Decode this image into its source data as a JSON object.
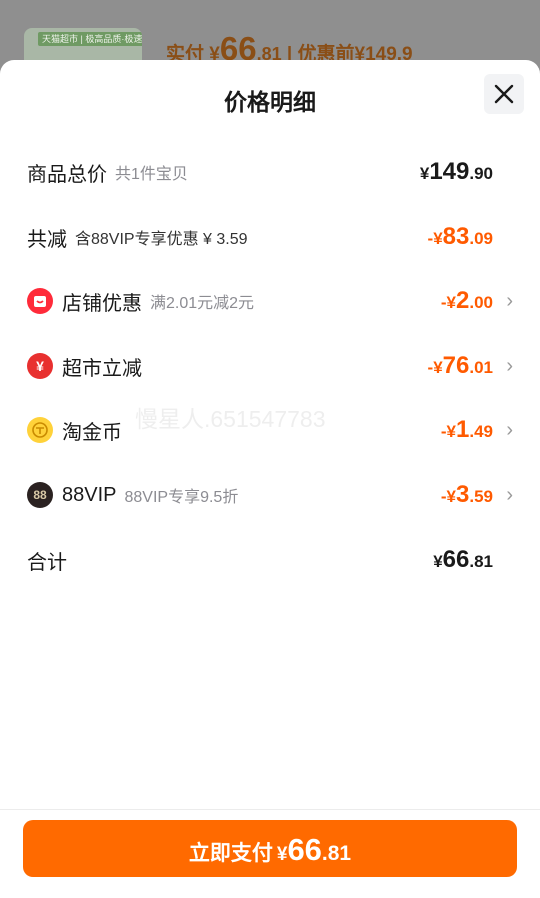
{
  "background": {
    "thumb_tag": "天猫超市 | 极高品质·极速送达",
    "price_prefix": "实付",
    "price_currency": "¥",
    "price_int": "66",
    "price_dec": ".81",
    "orig_label": "| 优惠前",
    "orig_price": "¥149.9"
  },
  "sheet": {
    "title": "价格明细",
    "close_icon": "close-icon"
  },
  "rows": {
    "goods_total": {
      "label": "商品总价",
      "sub": "共1件宝贝",
      "cur": "¥",
      "int": "149",
      "dec": ".90"
    },
    "total_discount": {
      "label": "共减",
      "sub": "含88VIP专享优惠 ¥ 3.59",
      "cur": "-¥",
      "int": "83",
      "dec": ".09"
    },
    "shop_coupon": {
      "label": "店铺优惠",
      "sub": "满2.01元减2元",
      "cur": "-¥",
      "int": "2",
      "dec": ".00",
      "icon": "shop-icon"
    },
    "market_discount": {
      "label": "超市立减",
      "cur": "-¥",
      "int": "76",
      "dec": ".01",
      "icon": "market-discount-icon"
    },
    "gold_coin": {
      "label": "淘金币",
      "cur": "-¥",
      "int": "1",
      "dec": ".49",
      "icon": "coin-icon"
    },
    "vip": {
      "label": "88VIP",
      "sub": "88VIP专享9.5折",
      "cur": "-¥",
      "int": "3",
      "dec": ".59",
      "icon": "vip-88-icon"
    },
    "sum": {
      "label": "合计",
      "cur": "¥",
      "int": "66",
      "dec": ".81"
    }
  },
  "pay_button": {
    "label": "立即支付",
    "cur": "¥",
    "int": "66",
    "dec": ".81"
  },
  "watermark": "慢星人.651547783",
  "colors": {
    "accent": "#ff6a00",
    "discount": "#ff5a00"
  }
}
